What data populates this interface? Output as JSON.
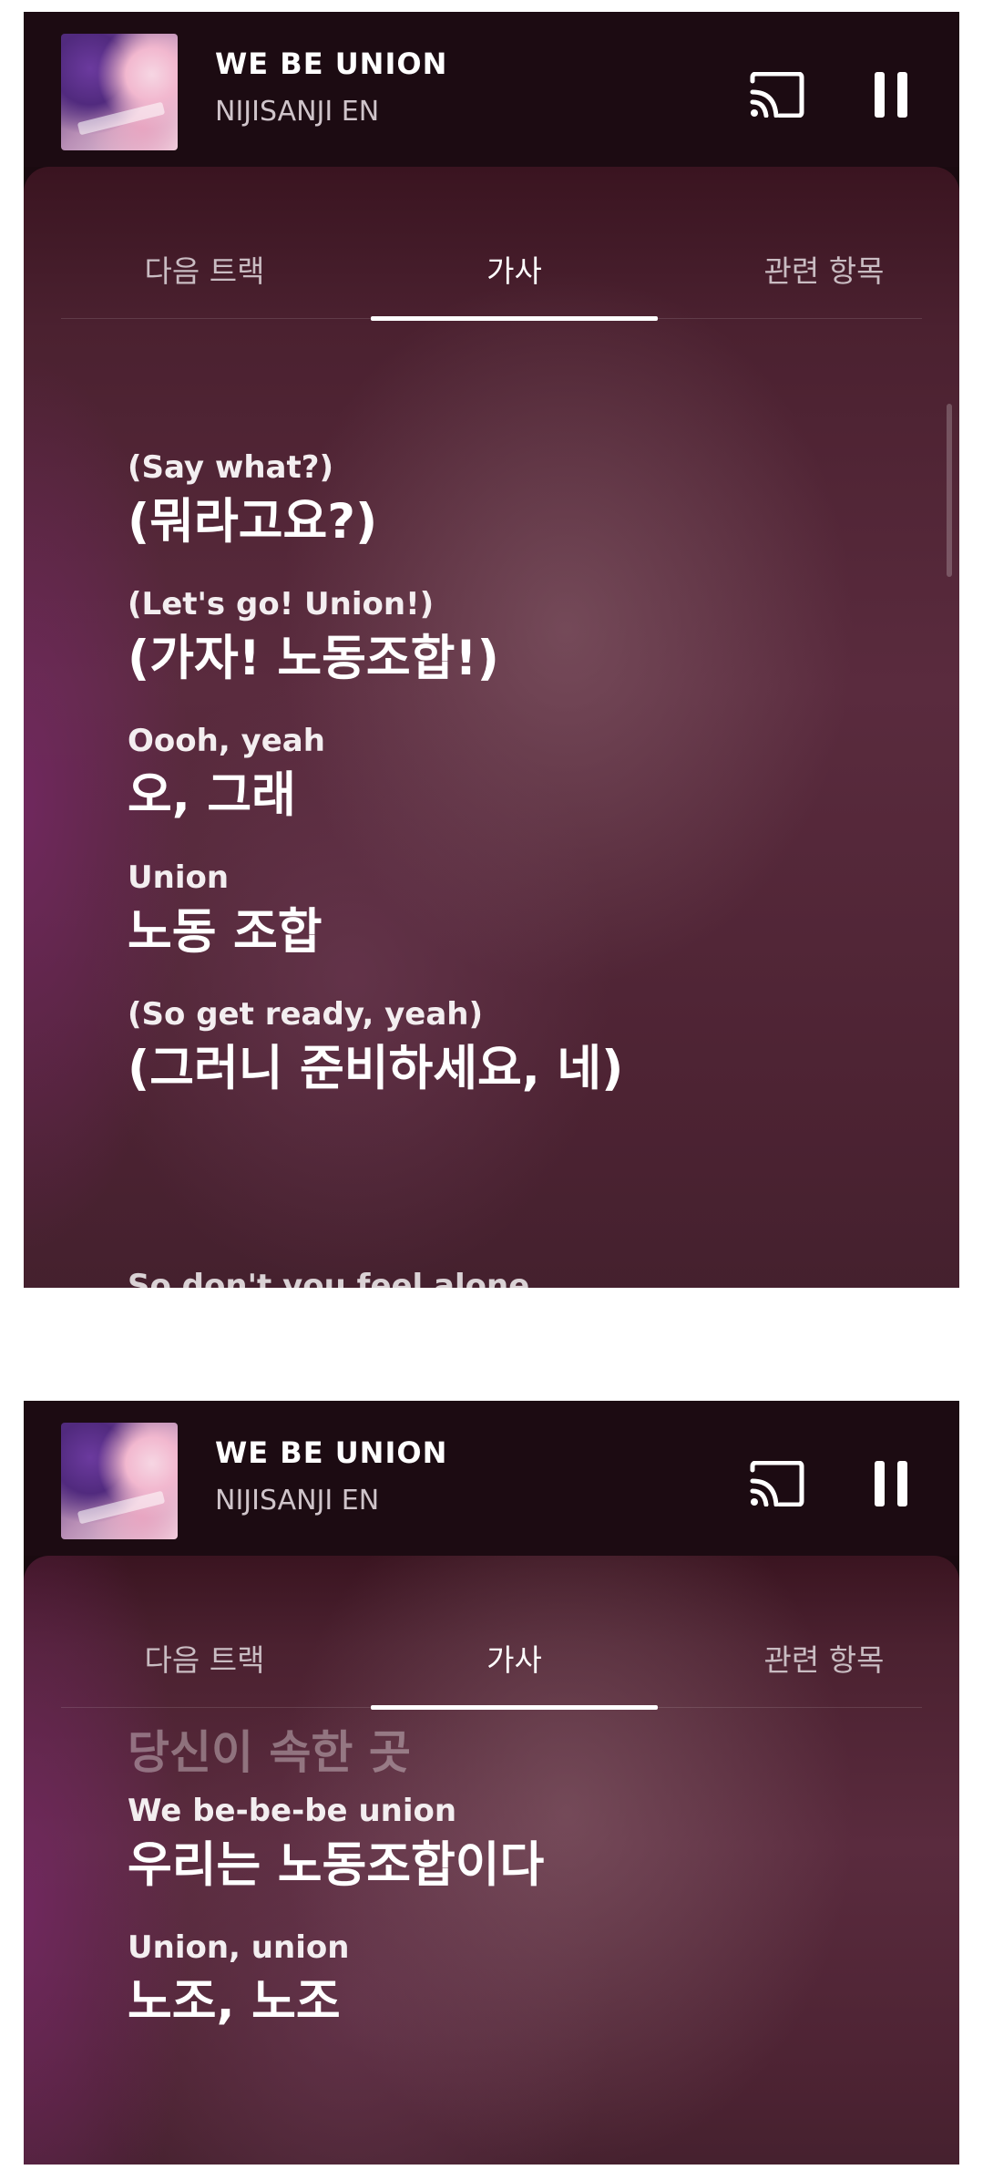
{
  "player": {
    "title": "WE BE UNION",
    "artist": "NIJISANJI EN"
  },
  "icons": {
    "cast": "cast-icon",
    "pause": "pause-icon"
  },
  "tabs": [
    {
      "label": "다음 트랙",
      "active": false
    },
    {
      "label": "가사",
      "active": true
    },
    {
      "label": "관련 항목",
      "active": false
    }
  ],
  "lyrics_top": [
    {
      "en": "(Say what?)",
      "ko": "(뭐라고요?)"
    },
    {
      "en": "(Let's go! Union!)",
      "ko": "(가자! 노동조합!)"
    },
    {
      "en": "Oooh, yeah",
      "ko": "오, 그래"
    },
    {
      "en": "Union",
      "ko": "노동 조합"
    },
    {
      "en": "(So get ready, yeah)",
      "ko": "(그러니 준비하세요, 네)"
    }
  ],
  "lyrics_top_cut": "So don't you feel alone",
  "lyrics_bottom_cut": "당신이 속한 곳",
  "lyrics_bottom": [
    {
      "en": "We be-be-be union",
      "ko": "우리는 노동조합이다"
    },
    {
      "en": "Union, union",
      "ko": "노조, 노조"
    }
  ],
  "colors": {
    "background": "#1a0a10",
    "panel": "#4b2130",
    "text": "#ffffff",
    "muted": "#c9bcc2"
  }
}
